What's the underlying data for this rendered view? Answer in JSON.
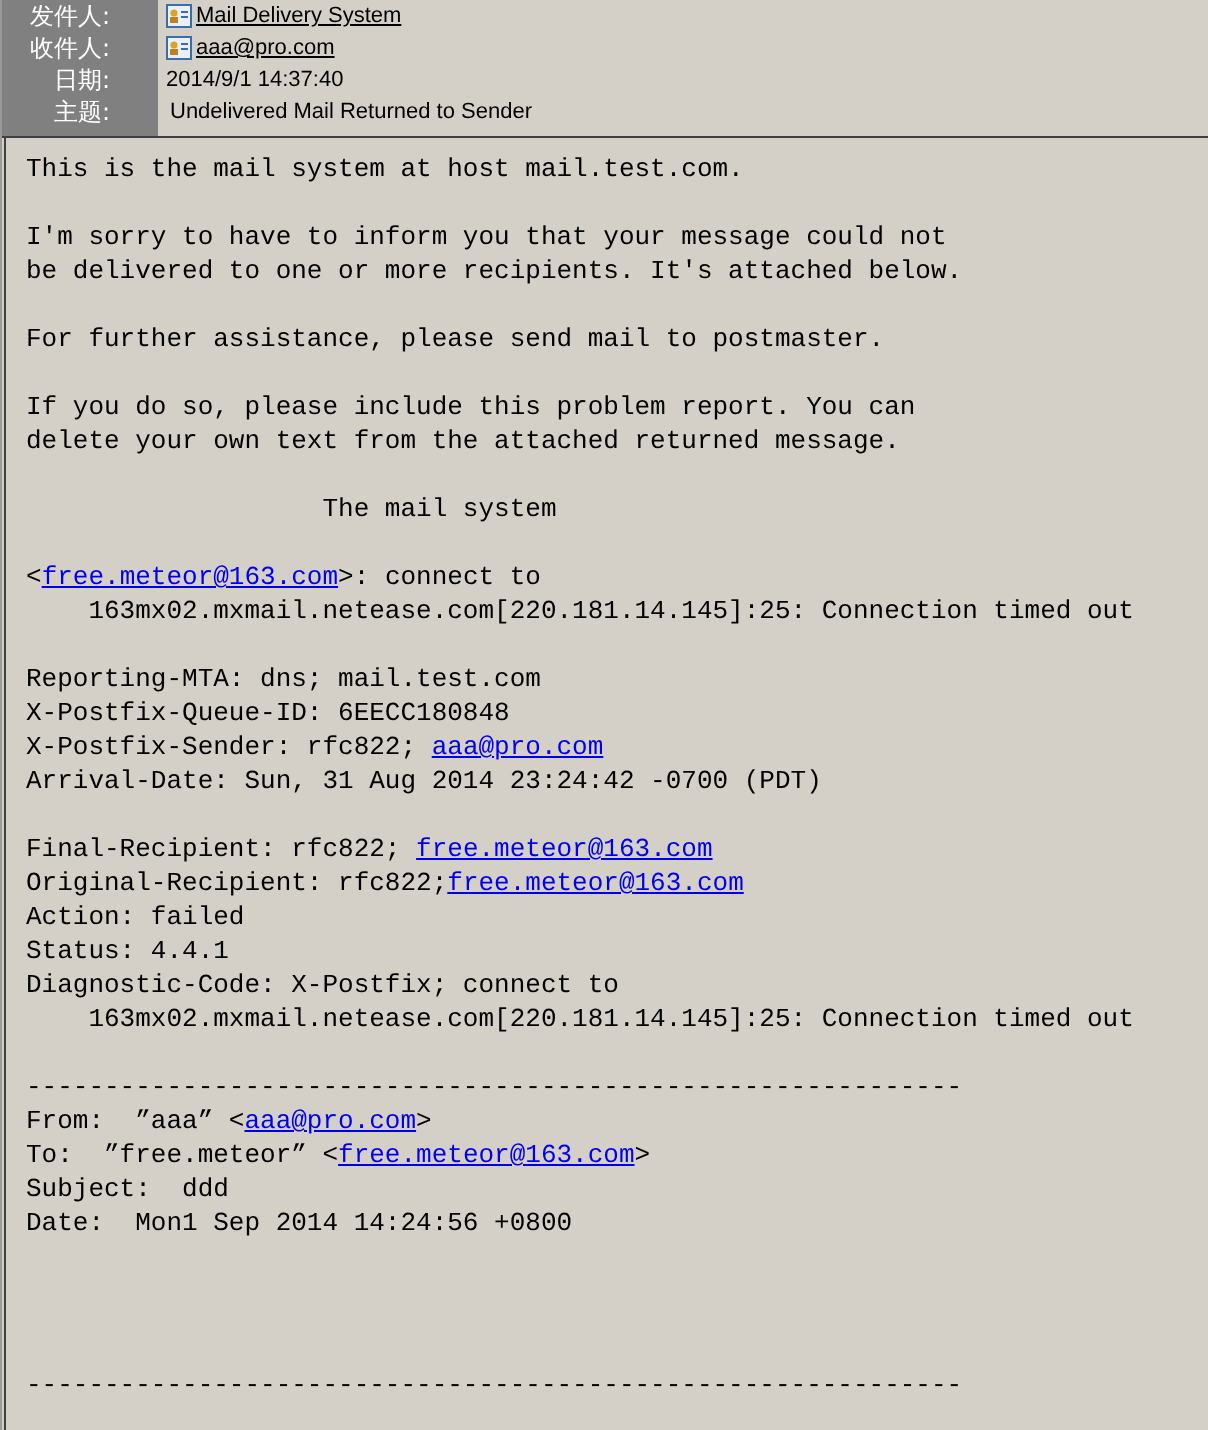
{
  "header": [
    {
      "label": "发件人:",
      "kind": "contact",
      "value": "Mail Delivery System"
    },
    {
      "label": "收件人:",
      "kind": "contact",
      "value": "aaa@pro.com"
    },
    {
      "label": "日期:",
      "kind": "text",
      "value": "2014/9/1 14:37:40"
    },
    {
      "label": "主题:",
      "kind": "text",
      "value": "Undelivered Mail Returned to Sender"
    }
  ],
  "body": [
    {
      "lines": [
        [
          {
            "text": "This is the mail system at host mail.test.com.",
            "link": false
          }
        ]
      ]
    },
    {
      "lines": [
        [
          {
            "text": "I'm sorry to have to inform you that your message could not",
            "link": false
          }
        ],
        [
          {
            "text": "be delivered to one or more recipients. It's attached below.",
            "link": false
          }
        ]
      ]
    },
    {
      "lines": [
        [
          {
            "text": "For further assistance, please send mail to postmaster.",
            "link": false
          }
        ]
      ]
    },
    {
      "lines": [
        [
          {
            "text": "If you do so, please include this problem report. You can",
            "link": false
          }
        ],
        [
          {
            "text": "delete your own text from the attached returned message.",
            "link": false
          }
        ]
      ]
    },
    {
      "lines": [
        [
          {
            "text": "                   The mail system",
            "link": false
          }
        ]
      ]
    },
    {
      "lines": [
        [
          {
            "text": "<",
            "link": false
          },
          {
            "text": "free.meteor@163.com",
            "link": true
          },
          {
            "text": ">: connect to",
            "link": false
          }
        ],
        [
          {
            "text": "    163mx02.mxmail.netease.com[220.181.14.145]:25: Connection timed out",
            "link": false
          }
        ]
      ]
    },
    {
      "lines": [
        [
          {
            "text": "Reporting-MTA: dns; mail.test.com",
            "link": false
          }
        ],
        [
          {
            "text": "X-Postfix-Queue-ID: 6EECC180848",
            "link": false
          }
        ],
        [
          {
            "text": "X-Postfix-Sender: rfc822; ",
            "link": false
          },
          {
            "text": "aaa@pro.com",
            "link": true
          }
        ],
        [
          {
            "text": "Arrival-Date: Sun, 31 Aug 2014 23:24:42 -0700 (PDT)",
            "link": false
          }
        ]
      ]
    },
    {
      "lines": [
        [
          {
            "text": "Final-Recipient: rfc822; ",
            "link": false
          },
          {
            "text": "free.meteor@163.com",
            "link": true
          }
        ],
        [
          {
            "text": "Original-Recipient: rfc822;",
            "link": false
          },
          {
            "text": "free.meteor@163.com",
            "link": true
          }
        ],
        [
          {
            "text": "Action: failed",
            "link": false
          }
        ],
        [
          {
            "text": "Status: 4.4.1",
            "link": false
          }
        ],
        [
          {
            "text": "Diagnostic-Code: X-Postfix; connect to",
            "link": false
          }
        ],
        [
          {
            "text": "    163mx02.mxmail.netease.com[220.181.14.145]:25: Connection timed out",
            "link": false
          }
        ]
      ]
    },
    {
      "lines": [
        [
          {
            "text": "------------------------------------------------------------",
            "link": false
          }
        ],
        [
          {
            "text": "From:  ”aaa” <",
            "link": false
          },
          {
            "text": "aaa@pro.com",
            "link": true
          },
          {
            "text": ">",
            "link": false
          }
        ],
        [
          {
            "text": "To:  ”free.meteor” <",
            "link": false
          },
          {
            "text": "free.meteor@163.com",
            "link": true
          },
          {
            "text": ">",
            "link": false
          }
        ],
        [
          {
            "text": "Subject:  ddd",
            "link": false
          }
        ],
        [
          {
            "text": "Date:  Mon1 Sep 2014 14:24:56 +0800",
            "link": false
          }
        ]
      ]
    },
    {
      "lines": [
        [
          {
            "text": "------------------------------------------------------------",
            "link": false
          }
        ]
      ]
    }
  ]
}
